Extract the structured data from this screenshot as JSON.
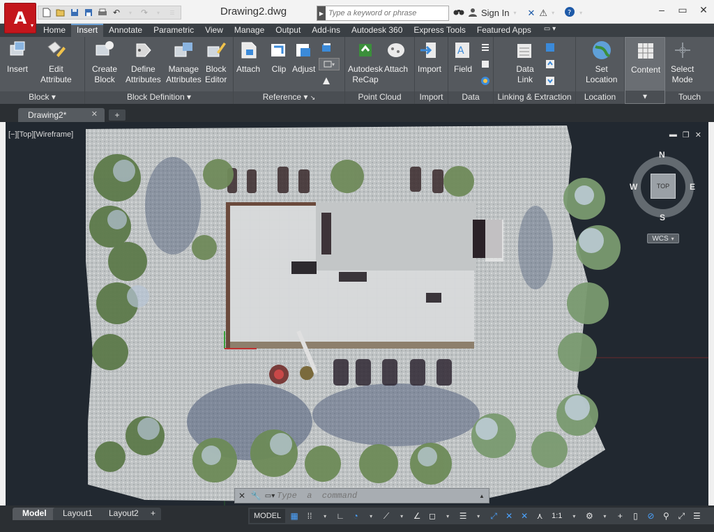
{
  "window": {
    "document_title": "Drawing2.dwg",
    "search_placeholder": "Type a keyword or phrase",
    "sign_in": "Sign In"
  },
  "ribbon_tabs": [
    "Home",
    "Insert",
    "Annotate",
    "Parametric",
    "View",
    "Manage",
    "Output",
    "Add-ins",
    "Autodesk 360",
    "Express Tools",
    "Featured Apps"
  ],
  "active_tab": "Insert",
  "panels": {
    "block": {
      "title": "Block",
      "buttons": [
        "Insert",
        "Edit\nAttribute"
      ]
    },
    "block_definition": {
      "title": "Block Definition",
      "buttons": [
        "Create\nBlock",
        "Define\nAttributes",
        "Manage\nAttributes",
        "Block\nEditor"
      ]
    },
    "reference": {
      "title": "Reference",
      "buttons": [
        "Attach",
        "Clip",
        "Adjust"
      ]
    },
    "point_cloud": {
      "title": "Point Cloud",
      "buttons": [
        "Autodesk\nReCap",
        "Attach"
      ]
    },
    "import": {
      "title": "Import",
      "buttons": [
        "Import"
      ]
    },
    "data": {
      "title": "Data",
      "buttons": [
        "Field"
      ]
    },
    "linking": {
      "title": "Linking & Extraction",
      "buttons": [
        "Data\nLink"
      ]
    },
    "location": {
      "title": "Location",
      "buttons": [
        "Set\nLocation"
      ]
    },
    "content": {
      "title": "",
      "buttons": [
        "Content"
      ]
    },
    "touch": {
      "title": "Touch",
      "buttons": [
        "Select\nMode"
      ]
    }
  },
  "doc_tab": "Drawing2*",
  "viewport": {
    "label": "[−][Top][Wireframe]",
    "viewcube": {
      "north": "N",
      "south": "S",
      "east": "E",
      "west": "W",
      "face": "TOP",
      "ucs": "WCS"
    }
  },
  "command_line": {
    "placeholder": "Type  a  command"
  },
  "layout_tabs": [
    "Model",
    "Layout1",
    "Layout2"
  ],
  "status": {
    "model": "MODEL",
    "scale": "1:1"
  }
}
